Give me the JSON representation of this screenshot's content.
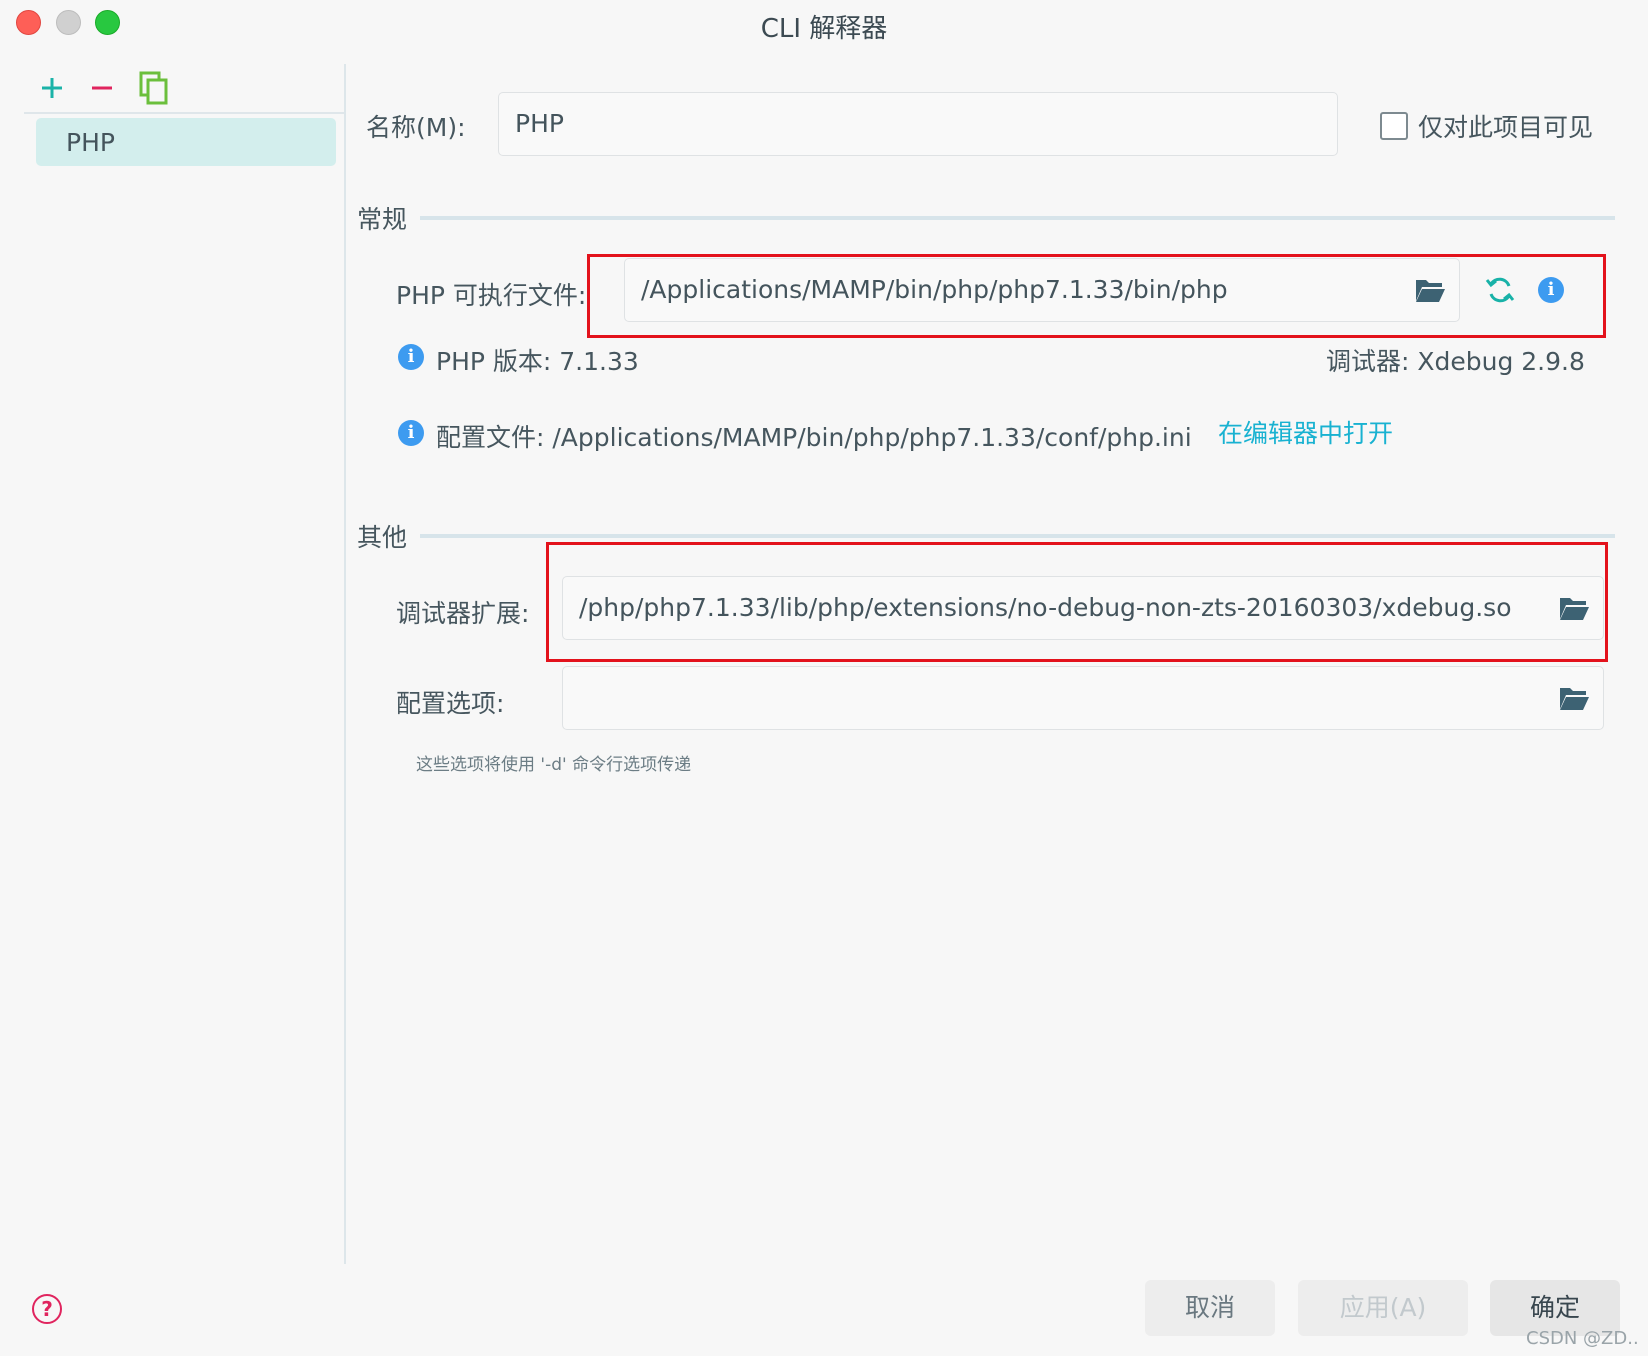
{
  "window": {
    "title": "CLI 解释器"
  },
  "sidebar": {
    "items": [
      {
        "label": "PHP"
      }
    ]
  },
  "name_row": {
    "label": "名称(M):",
    "value": "PHP",
    "checkbox_label": "仅对此项目可见",
    "checkbox_checked": false
  },
  "general": {
    "title": "常规",
    "executable_label": "PHP 可执行文件:",
    "executable_value": "/Applications/MAMP/bin/php/php7.1.33/bin/php",
    "php_version": "PHP 版本: 7.1.33",
    "debugger": "调试器: Xdebug 2.9.8",
    "config_file": "配置文件: /Applications/MAMP/bin/php/php7.1.33/conf/php.ini",
    "open_in_editor": "在编辑器中打开"
  },
  "other": {
    "title": "其他",
    "debugger_ext_label": "调试器扩展:",
    "debugger_ext_value": "/php/php7.1.33/lib/php/extensions/no-debug-non-zts-20160303/xdebug.so",
    "config_options_label": "配置选项:",
    "config_options_value": "",
    "hint": "这些选项将使用 '-d' 命令行选项传递"
  },
  "buttons": {
    "cancel": "取消",
    "apply": "应用(A)",
    "ok": "确定"
  },
  "help_symbol": "?",
  "watermark": "CSDN @ZD..",
  "colors": {
    "accent_teal": "#18b2d1",
    "selection": "#d3eeed",
    "highlight_red": "#e3121c",
    "info_blue": "#3d9bf0",
    "add_green": "#1bb3a8",
    "remove_red": "#e0245e"
  }
}
